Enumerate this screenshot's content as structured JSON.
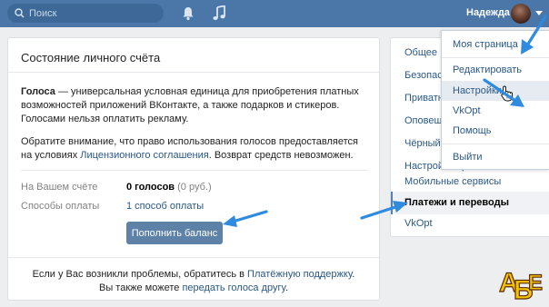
{
  "header": {
    "search_placeholder": "Поиск",
    "username": "Надежда",
    "icons": [
      "search-icon",
      "bell-icon",
      "music-note-icon",
      "chevron-down-icon"
    ],
    "color": "#4a76a8"
  },
  "card": {
    "title": "Состояние личного счёта",
    "info1_bold": "Голоса",
    "info1_text": " — универсальная условная единица для приобретения платных возможностей приложений ВКонтакте, а также подарков и стикеров. Голосами нельзя оплатить рекламу.",
    "info2_prefix": "Обратите внимание, что право использования голосов предоставляется на условиях ",
    "info2_link": "Лицензионного соглашения",
    "info2_suffix": ". Возврат средств невозможен.",
    "balance_label": "На Вашем счёте",
    "balance_amount": "0 голосов",
    "balance_rub": " (0 руб.)",
    "methods_label": "Способы оплаты",
    "methods_link": "1 способ оплаты",
    "button_label": "Пополнить баланс",
    "footer1_prefix": "Если у Вас возникли проблемы, обратитесь в ",
    "footer1_link": "Платёжную поддержку",
    "footer1_suffix": ".",
    "footer2_prefix": "Вы также можете ",
    "footer2_link": "передать голоса другу",
    "footer2_suffix": "."
  },
  "right_menu": {
    "items": [
      {
        "label": "Общее"
      },
      {
        "label": "Безопасность"
      },
      {
        "label": "Приватность"
      },
      {
        "label": "Оповещения"
      },
      {
        "label": "Чёрный список"
      },
      {
        "label": "Настройки приложений"
      },
      {
        "label": "Мобильные сервисы"
      },
      {
        "label": "Платежи и переводы"
      },
      {
        "label": "VkOpt"
      }
    ],
    "active": "Платежи и переводы"
  },
  "dropdown": {
    "items": [
      {
        "label": "Моя страница"
      },
      {
        "label": "Редактировать"
      },
      {
        "label": "Настройки"
      },
      {
        "label": "VkOpt"
      },
      {
        "label": "Помощь"
      },
      {
        "label": "Выйти"
      }
    ],
    "hovered": "Настройки"
  },
  "overlay": {
    "logo_text": "АБЕ",
    "arrow_color": "#2e8be0",
    "logo_color": "#f5c400"
  }
}
